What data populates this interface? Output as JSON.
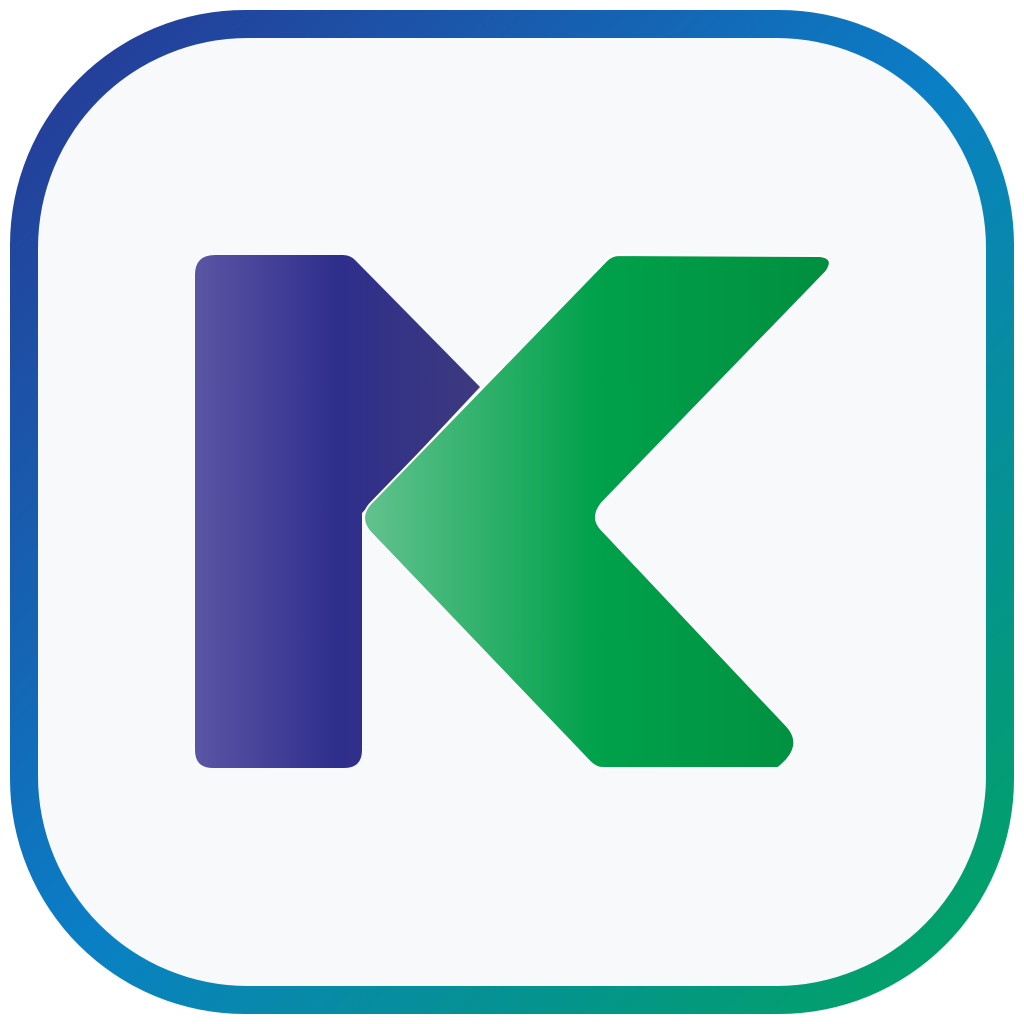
{
  "icon": {
    "name": "k-logo-icon",
    "letter": "K",
    "colors": {
      "frame_start": "#283593",
      "frame_mid": "#0a7fc6",
      "frame_end": "#00a65a",
      "tile_background": "#f8f9fb",
      "stem_light": "#5b55a4",
      "stem_dark": "#2e2e8c",
      "arm_dark": "#3d3a7e",
      "chevron_light": "#63c28e",
      "chevron_mid": "#00a14b",
      "chevron_dark": "#008f3f"
    }
  }
}
